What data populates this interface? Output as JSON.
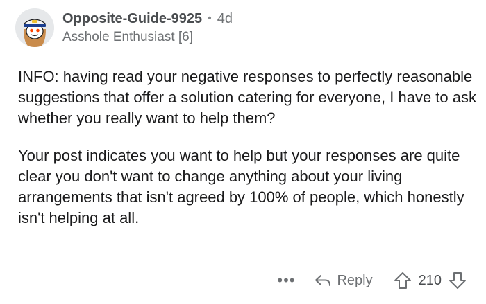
{
  "comment": {
    "username": "Opposite-Guide-9925",
    "separator": "•",
    "age": "4d",
    "flair": "Asshole Enthusiast [6]",
    "paragraphs": [
      "INFO: having read your negative responses to perfectly reasonable suggestions that offer a solution catering for everyone, I have to ask whether you really want to help them?",
      "Your post indicates you want to help but your responses are quite clear you don't want to change anything about your living arrangements that isn't agreed by 100% of people, which honestly isn't helping at all."
    ]
  },
  "actions": {
    "more_label": "•••",
    "reply_label": "Reply",
    "score": "210"
  },
  "icons": {
    "avatar": "snoo-avatar-captain-hat",
    "reply": "reply-arrow-icon",
    "upvote": "upvote-arrow-icon",
    "downvote": "downvote-arrow-icon"
  },
  "colors": {
    "text_primary": "#1a1a1b",
    "text_meta": "#6d7073",
    "username": "#4a4d50"
  }
}
